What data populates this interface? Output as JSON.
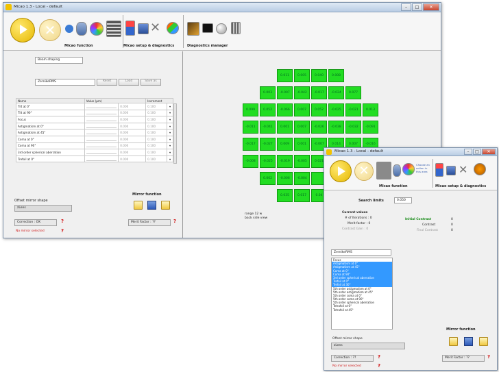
{
  "back_window": {
    "title": "Micao 1.3 - Local - default",
    "sections": {
      "function": "Micao function",
      "setup": "Micao setup & diagnostics",
      "diagnostics": "Diagnostics manager"
    },
    "beam_shaping_btn": "Beam shaping",
    "mode_select": "ZernikeRMS",
    "buttons": {
      "reset": "Reset",
      "load": "Load",
      "save_as": "Save as"
    },
    "table_headers": {
      "name": "Name",
      "value": "Value (µm)",
      "increment": "Increment"
    },
    "params": [
      {
        "name": "Tilt at 0°",
        "value": "0.000",
        "incr": "0.100"
      },
      {
        "name": "Tilt at 90°",
        "value": "0.000",
        "incr": "0.100"
      },
      {
        "name": "Focus",
        "value": "0.000",
        "incr": "0.100"
      },
      {
        "name": "Astigmatism at 0°",
        "value": "0.000",
        "incr": "0.100"
      },
      {
        "name": "Astigmatism at 45°",
        "value": "0.000",
        "incr": "0.100"
      },
      {
        "name": "Coma at 0°",
        "value": "0.000",
        "incr": "0.100"
      },
      {
        "name": "Coma at 90°",
        "value": "0.000",
        "incr": "0.100"
      },
      {
        "name": "3rd order spherical aberration",
        "value": "0.000",
        "incr": "0.100"
      },
      {
        "name": "Trefoil at 0°",
        "value": "0.000",
        "incr": "0.100"
      }
    ],
    "offset_label": "Offset mirror shape",
    "offset_value": "zLens",
    "mirror_function": "Mirror function",
    "correction": "Correction : OK",
    "no_mirror": "No mirror selected",
    "merit_factor": "Merit Factor : ??",
    "map_caption": "range 12 w\nback side view",
    "map_rows": [
      [
        "0.011",
        "0.005",
        "0.040",
        "0.008"
      ],
      [
        "0.003",
        "-0.007",
        "-0.042",
        "-0.017",
        "-0.024",
        "0.077"
      ],
      [
        "0.099",
        "0.052",
        "-0.066",
        "0.007",
        "0.052",
        "-0.025",
        "-0.021",
        "0.013"
      ],
      [
        "-0.011",
        "-0.041",
        "0.001",
        "0.007",
        "-0.026",
        "-0.038",
        "-0.032",
        "-0.091"
      ],
      [
        "-0.017",
        "-0.027",
        "0.009",
        "0.001",
        "-0.007",
        "0.014",
        "0.007",
        "-0.016"
      ],
      [
        "-0.008",
        "-0.025",
        "-0.019",
        "-0.005",
        "0.021",
        "",
        "",
        ""
      ],
      [
        "0.062",
        "-0.006",
        "-0.004",
        "",
        "",
        ""
      ],
      [
        "0.035",
        "0.017",
        "0.04",
        ""
      ]
    ]
  },
  "front_window": {
    "title": "Micao 1.3 - Local - default",
    "sections": {
      "function": "Micao function",
      "setup": "Micao setup & diagnostics"
    },
    "hint": "Choose an action in this area",
    "search_limits_label": "Search limits",
    "search_limits_value": "0.050",
    "current_values": "Current values",
    "iterations": "# of Iterations : 0",
    "merit_factor": "Merit factor : 0",
    "contrast_gain": "Contrast Gain : 0",
    "initial_contrast": "Initial Contrast",
    "contrast": "Contrast",
    "final_contrast": "Final Contrast",
    "initial_val": "0",
    "contrast_val": "0",
    "final_val": "0",
    "mode_select": "ZernikeRMS",
    "mode_list": [
      {
        "label": "Focus",
        "selected": false
      },
      {
        "label": "Astigmatism at 0°",
        "selected": true
      },
      {
        "label": "Astigmatism at 45°",
        "selected": true
      },
      {
        "label": "Coma at 0°",
        "selected": true
      },
      {
        "label": "Coma at 90°",
        "selected": true
      },
      {
        "label": "3rd order spherical aberration",
        "selected": true
      },
      {
        "label": "Trefoil at 0°",
        "selected": true
      },
      {
        "label": "Trefoil at 30°",
        "selected": true
      },
      {
        "label": "5th order astigmatism at 0°",
        "selected": false
      },
      {
        "label": "5th order astigmatism at 45°",
        "selected": false
      },
      {
        "label": "5th order coma at 0°",
        "selected": false
      },
      {
        "label": "5th order coma at 90°",
        "selected": false
      },
      {
        "label": "5th order spherical aberration",
        "selected": false
      },
      {
        "label": "Tetrafoil at 0°",
        "selected": false
      },
      {
        "label": "Tetrafoil at 45°",
        "selected": false
      }
    ],
    "mirror_function": "Mirror function",
    "offset_label": "Offset mirror shape",
    "offset_value": "zLens",
    "correction": "Correction : ??",
    "no_mirror": "No mirror selected",
    "merit_factor_box": "Merit Factor : ??"
  }
}
